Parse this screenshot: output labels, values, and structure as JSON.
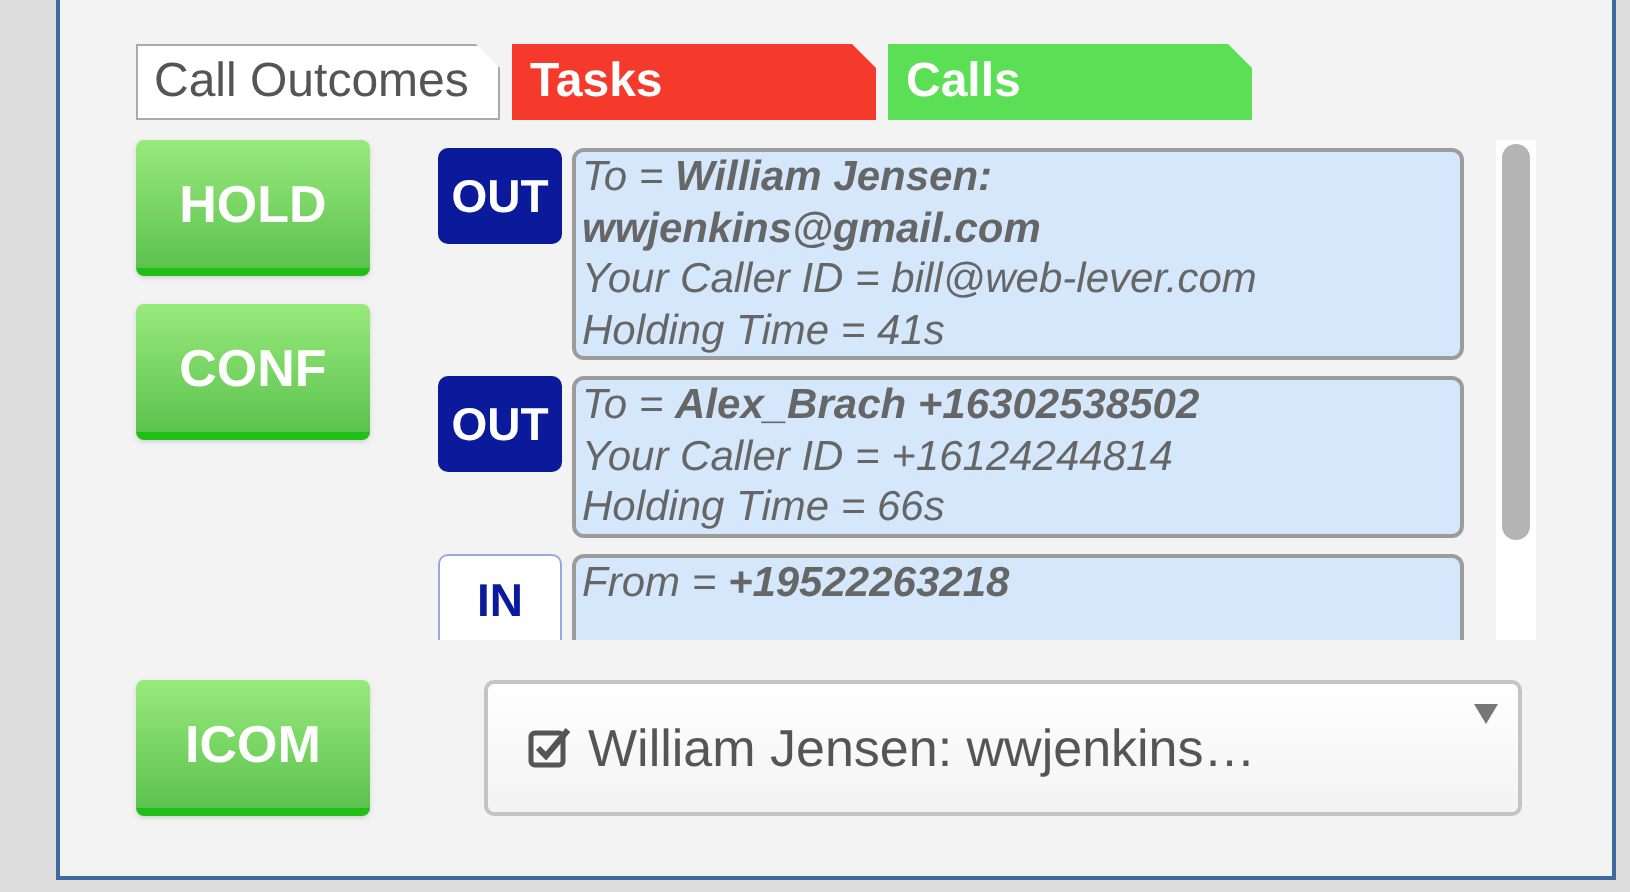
{
  "tabs": [
    {
      "label": "Call Outcomes",
      "kind": "outcomes",
      "selected": true
    },
    {
      "label": "Tasks",
      "kind": "tasks",
      "selected": false
    },
    {
      "label": "Calls",
      "kind": "calls",
      "selected": false
    }
  ],
  "buttons": [
    "HOLD",
    "CONF"
  ],
  "calls": [
    {
      "direction": "OUT",
      "kind": "out",
      "lines": [
        "To = **William Jensen: wwjenkins@gmail.com**",
        "Your Caller ID = bill@web-lever.com",
        "Holding Time = 41s"
      ]
    },
    {
      "direction": "OUT",
      "kind": "out",
      "lines": [
        "To = **Alex_Brach +16302538502**",
        "Your Caller ID = +16124244814",
        "Holding Time = 66s"
      ]
    },
    {
      "direction": "IN",
      "kind": "in",
      "lines": [
        "From = **+19522263218**"
      ]
    }
  ],
  "intercom_button": "ICOM",
  "selector": {
    "value": "William Jensen: wwjenkins…",
    "checked": true
  }
}
